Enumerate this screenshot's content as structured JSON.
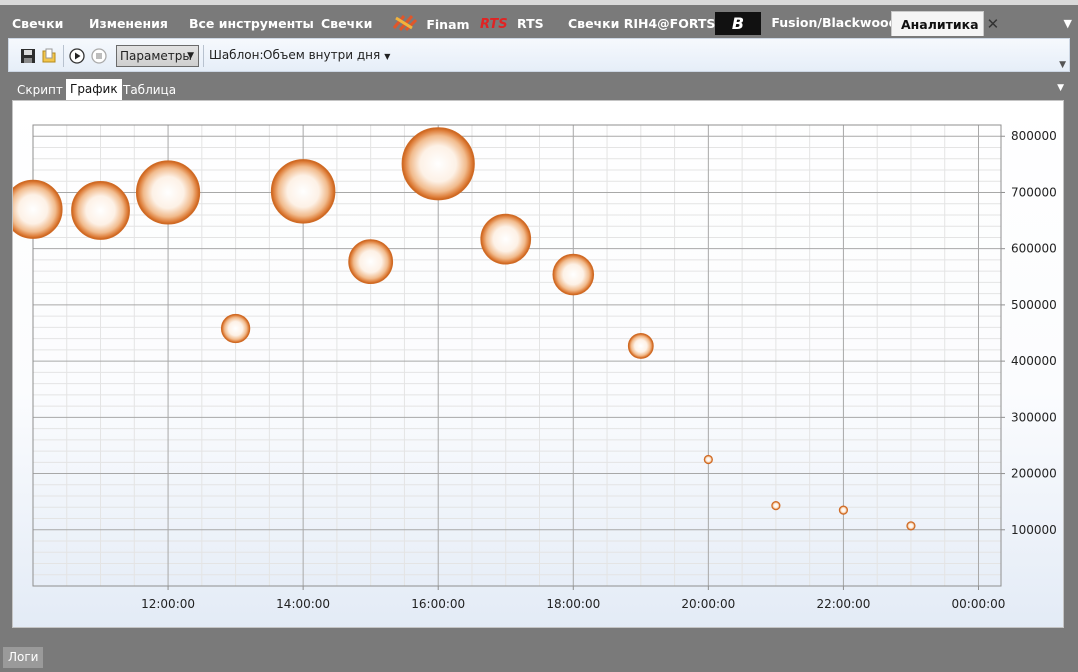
{
  "tabs": [
    {
      "label": "Свечки",
      "icon": ""
    },
    {
      "label": "Изменения",
      "icon": ""
    },
    {
      "label": "Все инструменты",
      "icon": ""
    },
    {
      "label": "Свечки",
      "icon": ""
    },
    {
      "label": "Finam",
      "icon": "finam-logo-icon"
    },
    {
      "label": "RTS",
      "icon": "rts-logo-icon",
      "icon_text": "RTS"
    },
    {
      "label": "Свечки RIH4@FORTS",
      "icon": ""
    },
    {
      "label": "Fusion/Blackwood",
      "icon": "blackwood-logo-icon",
      "icon_text": "B"
    },
    {
      "label": "Аналитика",
      "icon": "",
      "active": true
    }
  ],
  "toolbar": {
    "params_label": "Параметры",
    "template_label": "Шаблон:",
    "template_value": "Объем внутри дня"
  },
  "subtabs": [
    {
      "label": "Скрипт"
    },
    {
      "label": "График",
      "active": true
    },
    {
      "label": "Таблица"
    }
  ],
  "bottom": {
    "logs_label": "Логи"
  },
  "colors": {
    "bubble_edge": "#d4691c",
    "bubble_center": "#ffffff",
    "grid": "#9c9c9c",
    "background_bottom": "#e3ebf6"
  },
  "chart_data": {
    "type": "scatter",
    "variant": "bubble",
    "xlabel": "",
    "ylabel": "",
    "x_ticks": [
      "12:00:00",
      "14:00:00",
      "16:00:00",
      "18:00:00",
      "20:00:00",
      "22:00:00",
      "00:00:00"
    ],
    "y_ticks": [
      "100000",
      "200000",
      "300000",
      "400000",
      "500000",
      "600000",
      "700000",
      "800000"
    ],
    "xlim": [
      "10:00:00",
      "00:20:00"
    ],
    "ylim": [
      0,
      820000
    ],
    "y_axis_side": "right",
    "grid": true,
    "points": [
      {
        "x": "10:00:00",
        "y": 670000
      },
      {
        "x": "11:00:00",
        "y": 668000
      },
      {
        "x": "12:00:00",
        "y": 700000
      },
      {
        "x": "13:00:00",
        "y": 458000
      },
      {
        "x": "14:00:00",
        "y": 702000
      },
      {
        "x": "15:00:00",
        "y": 577000
      },
      {
        "x": "16:00:00",
        "y": 751000
      },
      {
        "x": "17:00:00",
        "y": 617000
      },
      {
        "x": "18:00:00",
        "y": 554000
      },
      {
        "x": "19:00:00",
        "y": 427000
      },
      {
        "x": "20:00:00",
        "y": 225000
      },
      {
        "x": "21:00:00",
        "y": 143000
      },
      {
        "x": "22:00:00",
        "y": 135000
      },
      {
        "x": "23:00:00",
        "y": 107000
      }
    ]
  }
}
